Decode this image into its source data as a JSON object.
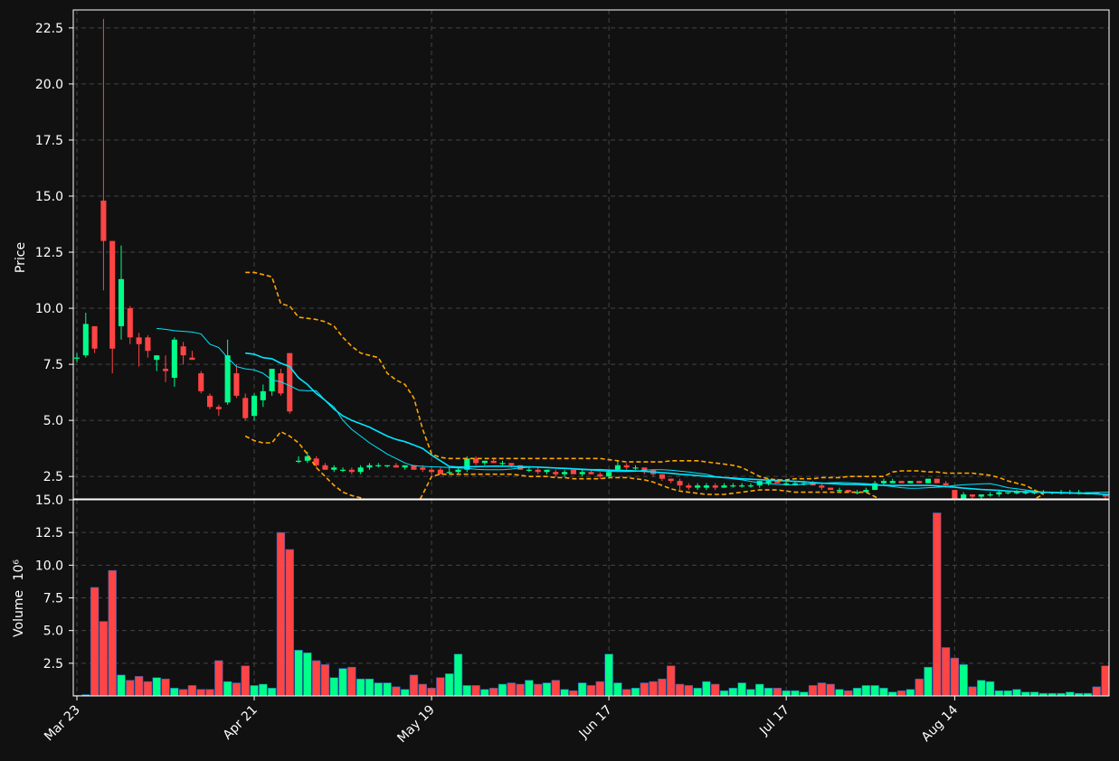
{
  "chart_data": [
    {
      "type": "candlestick",
      "ylabel": "Price",
      "ylim": [
        1.5,
        23.3
      ],
      "yticks": [
        "2.5",
        "5.0",
        "7.5",
        "10.0",
        "12.5",
        "15.0",
        "17.5",
        "20.0",
        "22.5"
      ],
      "grid": true,
      "up_color": "#00ff88",
      "down_color": "#ff4444",
      "ohlc": [
        [
          7.8,
          8.0,
          7.6,
          7.8
        ],
        [
          7.9,
          9.8,
          7.8,
          9.3
        ],
        [
          9.2,
          9.2,
          8.0,
          8.2
        ],
        [
          14.8,
          22.9,
          10.8,
          13.0
        ],
        [
          13.0,
          13.0,
          7.1,
          8.2
        ],
        [
          9.2,
          12.8,
          8.6,
          11.3
        ],
        [
          10.0,
          10.1,
          8.4,
          8.7
        ],
        [
          8.7,
          8.9,
          7.4,
          8.4
        ],
        [
          8.7,
          8.8,
          7.8,
          8.1
        ],
        [
          7.7,
          7.9,
          7.2,
          7.9
        ],
        [
          7.3,
          7.9,
          6.7,
          7.2
        ],
        [
          6.9,
          8.7,
          6.5,
          8.6
        ],
        [
          8.3,
          8.5,
          7.5,
          7.9
        ],
        [
          7.8,
          8.1,
          7.7,
          7.7
        ],
        [
          7.1,
          7.2,
          6.2,
          6.3
        ],
        [
          6.1,
          6.2,
          5.5,
          5.6
        ],
        [
          5.6,
          5.7,
          5.2,
          5.5
        ],
        [
          5.8,
          8.6,
          5.7,
          7.9
        ],
        [
          7.1,
          7.5,
          6.0,
          6.1
        ],
        [
          6.0,
          6.2,
          5.0,
          5.1
        ],
        [
          5.2,
          6.2,
          5.0,
          6.1
        ],
        [
          5.9,
          6.6,
          5.6,
          6.3
        ],
        [
          6.3,
          7.3,
          6.1,
          7.3
        ],
        [
          7.1,
          7.3,
          6.1,
          6.2
        ],
        [
          8.0,
          8.0,
          5.3,
          5.4
        ],
        [
          3.2,
          3.4,
          3.1,
          3.2
        ],
        [
          3.2,
          3.6,
          3.1,
          3.4
        ],
        [
          3.3,
          3.4,
          2.9,
          3.0
        ],
        [
          3.0,
          3.1,
          2.8,
          2.8
        ],
        [
          2.8,
          3.0,
          2.7,
          2.9
        ],
        [
          2.8,
          2.9,
          2.7,
          2.8
        ],
        [
          2.8,
          2.9,
          2.6,
          2.7
        ],
        [
          2.7,
          3.0,
          2.6,
          2.9
        ],
        [
          2.9,
          3.1,
          2.8,
          3.0
        ],
        [
          3.0,
          3.1,
          2.9,
          3.0
        ],
        [
          3.0,
          3.0,
          2.9,
          3.0
        ],
        [
          3.0,
          3.1,
          2.9,
          2.9
        ],
        [
          2.9,
          3.0,
          2.8,
          3.0
        ],
        [
          3.0,
          3.0,
          2.8,
          2.8
        ],
        [
          2.9,
          3.0,
          2.7,
          2.8
        ],
        [
          2.8,
          2.9,
          2.6,
          2.7
        ],
        [
          2.8,
          2.9,
          2.6,
          2.6
        ],
        [
          2.7,
          2.9,
          2.6,
          2.7
        ],
        [
          2.7,
          2.9,
          2.6,
          2.8
        ],
        [
          2.8,
          3.4,
          2.7,
          3.3
        ],
        [
          3.3,
          3.4,
          3.0,
          3.1
        ],
        [
          3.1,
          3.2,
          3.0,
          3.2
        ],
        [
          3.2,
          3.3,
          3.1,
          3.1
        ],
        [
          3.1,
          3.2,
          3.0,
          3.1
        ],
        [
          3.1,
          3.1,
          2.9,
          3.0
        ],
        [
          3.0,
          3.0,
          2.8,
          2.8
        ],
        [
          2.8,
          2.9,
          2.7,
          2.8
        ],
        [
          2.8,
          2.9,
          2.6,
          2.7
        ],
        [
          2.7,
          2.8,
          2.6,
          2.8
        ],
        [
          2.7,
          2.8,
          2.5,
          2.6
        ],
        [
          2.6,
          2.8,
          2.5,
          2.7
        ],
        [
          2.8,
          2.8,
          2.6,
          2.6
        ],
        [
          2.6,
          2.8,
          2.5,
          2.7
        ],
        [
          2.7,
          2.8,
          2.6,
          2.6
        ],
        [
          2.6,
          2.7,
          2.4,
          2.5
        ],
        [
          2.5,
          2.8,
          2.4,
          2.7
        ],
        [
          2.8,
          3.2,
          2.7,
          3.0
        ],
        [
          3.0,
          3.1,
          2.8,
          2.9
        ],
        [
          2.9,
          3.0,
          2.8,
          2.9
        ],
        [
          2.9,
          2.9,
          2.6,
          2.7
        ],
        [
          2.8,
          2.8,
          2.5,
          2.6
        ],
        [
          2.6,
          2.6,
          2.3,
          2.4
        ],
        [
          2.4,
          2.4,
          2.2,
          2.3
        ],
        [
          2.3,
          2.4,
          1.9,
          2.1
        ],
        [
          2.1,
          2.2,
          1.9,
          2.0
        ],
        [
          2.0,
          2.2,
          1.9,
          2.1
        ],
        [
          2.0,
          2.2,
          1.9,
          2.1
        ],
        [
          2.1,
          2.2,
          1.9,
          2.0
        ],
        [
          2.0,
          2.2,
          2.0,
          2.1
        ],
        [
          2.1,
          2.2,
          2.0,
          2.1
        ],
        [
          2.1,
          2.2,
          2.0,
          2.1
        ],
        [
          2.1,
          2.2,
          2.0,
          2.1
        ],
        [
          2.1,
          2.3,
          2.0,
          2.3
        ],
        [
          2.2,
          2.4,
          2.1,
          2.3
        ],
        [
          2.3,
          2.4,
          2.2,
          2.2
        ],
        [
          2.2,
          2.3,
          2.1,
          2.2
        ],
        [
          2.2,
          2.3,
          2.1,
          2.2
        ],
        [
          2.2,
          2.3,
          2.1,
          2.2
        ],
        [
          2.2,
          2.3,
          2.1,
          2.1
        ],
        [
          2.1,
          2.2,
          1.9,
          2.0
        ],
        [
          2.0,
          2.0,
          1.9,
          1.9
        ],
        [
          1.9,
          2.0,
          1.8,
          1.9
        ],
        [
          1.9,
          1.9,
          1.8,
          1.8
        ],
        [
          1.8,
          1.9,
          1.7,
          1.8
        ],
        [
          1.8,
          2.0,
          1.8,
          1.9
        ],
        [
          1.9,
          2.3,
          1.9,
          2.2
        ],
        [
          2.2,
          2.4,
          2.1,
          2.3
        ],
        [
          2.2,
          2.4,
          2.2,
          2.3
        ],
        [
          2.3,
          2.3,
          2.2,
          2.2
        ],
        [
          2.2,
          2.3,
          2.2,
          2.3
        ],
        [
          2.3,
          2.3,
          2.2,
          2.2
        ],
        [
          2.2,
          2.4,
          2.2,
          2.4
        ],
        [
          2.4,
          2.4,
          2.2,
          2.2
        ],
        [
          2.2,
          2.3,
          2.0,
          2.1
        ],
        [
          1.9,
          1.9,
          1.4,
          1.5
        ],
        [
          1.5,
          1.8,
          1.4,
          1.7
        ],
        [
          1.7,
          1.7,
          1.5,
          1.6
        ],
        [
          1.6,
          1.7,
          1.5,
          1.7
        ],
        [
          1.7,
          1.8,
          1.6,
          1.7
        ],
        [
          1.7,
          1.9,
          1.6,
          1.8
        ],
        [
          1.8,
          1.8,
          1.7,
          1.8
        ],
        [
          1.8,
          1.9,
          1.7,
          1.8
        ],
        [
          1.8,
          1.9,
          1.7,
          1.8
        ],
        [
          1.8,
          1.9,
          1.7,
          1.8
        ],
        [
          1.8,
          1.9,
          1.7,
          1.8
        ],
        [
          1.8,
          1.8,
          1.7,
          1.8
        ],
        [
          1.8,
          1.9,
          1.7,
          1.8
        ],
        [
          1.8,
          1.9,
          1.7,
          1.8
        ],
        [
          1.8,
          1.9,
          1.7,
          1.8
        ],
        [
          1.7,
          1.8,
          1.7,
          1.8
        ],
        [
          1.8,
          1.8,
          1.7,
          1.7
        ],
        [
          1.7,
          1.7,
          1.5,
          1.6
        ]
      ],
      "mavs": [
        {
          "color": "#00e5ff",
          "start": 9,
          "values": [
            9.1,
            9.06,
            9.0,
            8.97,
            8.94,
            8.86,
            8.4,
            8.25,
            7.8,
            7.4,
            7.3,
            7.25,
            7.1,
            6.8,
            6.72,
            6.55,
            6.35,
            6.32,
            6.32,
            5.9,
            5.6,
            5.0,
            4.6,
            4.3,
            4.0,
            3.75,
            3.5,
            3.3,
            3.1,
            2.98,
            2.95,
            2.93,
            2.92,
            2.9,
            2.88,
            2.86,
            2.82,
            2.8,
            2.8,
            2.8,
            2.83,
            2.88,
            2.91,
            2.91,
            2.9,
            2.87,
            2.85,
            2.83,
            2.8,
            2.78,
            2.75,
            2.73,
            2.72,
            2.72,
            2.73,
            2.78,
            2.8,
            2.8,
            2.78,
            2.74,
            2.7,
            2.65,
            2.6,
            2.5,
            2.45,
            2.4,
            2.35,
            2.28,
            2.22,
            2.18,
            2.15,
            2.13,
            2.12,
            2.15,
            2.18,
            2.2,
            2.22,
            2.23,
            2.22,
            2.2,
            2.18,
            2.15,
            2.1,
            2.05,
            2.0,
            1.97,
            1.98,
            2.0,
            2.02,
            2.05,
            2.1,
            2.13,
            2.15,
            2.17,
            2.18,
            2.1,
            2.0,
            1.95,
            1.9,
            1.85,
            1.8,
            1.78,
            1.75,
            1.75,
            1.76,
            1.78,
            1.79,
            1.8,
            1.8,
            1.8,
            1.79,
            1.78,
            1.77,
            1.75,
            1.73
          ]
        },
        {
          "color": "#00e5ff",
          "start": 19,
          "values": [
            8.0,
            7.95,
            7.8,
            7.75,
            7.55,
            7.4,
            6.9,
            6.6,
            6.2,
            5.9,
            5.5,
            5.2,
            5.0,
            4.85,
            4.7,
            4.5,
            4.3,
            4.15,
            4.05,
            3.9,
            3.75,
            3.45,
            3.2,
            2.95,
            2.92,
            2.93,
            2.94,
            2.95,
            2.96,
            2.96,
            2.95,
            2.94,
            2.93,
            2.92,
            2.9,
            2.88,
            2.86,
            2.84,
            2.82,
            2.8,
            2.8,
            2.78,
            2.77,
            2.76,
            2.75,
            2.73,
            2.7,
            2.67,
            2.64,
            2.6,
            2.57,
            2.54,
            2.51,
            2.48,
            2.45,
            2.43,
            2.4,
            2.38,
            2.36,
            2.34,
            2.32,
            2.3,
            2.28,
            2.26,
            2.23,
            2.2,
            2.18,
            2.16,
            2.15,
            2.14,
            2.13,
            2.12,
            2.11,
            2.1,
            2.1,
            2.1,
            2.1,
            2.1,
            2.08,
            2.05,
            2.02,
            1.98,
            1.95,
            1.92,
            1.9,
            1.88,
            1.85,
            1.83,
            1.82,
            1.81,
            1.8,
            1.79,
            1.78,
            1.77,
            1.75,
            1.74,
            1.72,
            1.7,
            1.68
          ]
        },
        {
          "color": "#ffa500",
          "start": 19,
          "dashed": true,
          "values": [
            11.6,
            11.6,
            11.5,
            11.4,
            10.2,
            10.1,
            9.6,
            9.55,
            9.5,
            9.4,
            9.2,
            8.7,
            8.3,
            8.0,
            7.9,
            7.8,
            7.1,
            6.8,
            6.6,
            6.0,
            4.6,
            3.5,
            3.35,
            3.3,
            3.3,
            3.3,
            3.3,
            3.3,
            3.3,
            3.3,
            3.3,
            3.3,
            3.3,
            3.3,
            3.3,
            3.3,
            3.3,
            3.3,
            3.3,
            3.3,
            3.3,
            3.25,
            3.2,
            3.15,
            3.15,
            3.15,
            3.15,
            3.15,
            3.2,
            3.2,
            3.2,
            3.2,
            3.15,
            3.1,
            3.05,
            3.0,
            2.9,
            2.7,
            2.5,
            2.4,
            2.35,
            2.35,
            2.4,
            2.4,
            2.4,
            2.45,
            2.45,
            2.45,
            2.5,
            2.5,
            2.5,
            2.5,
            2.5,
            2.7,
            2.75,
            2.75,
            2.75,
            2.7,
            2.7,
            2.65,
            2.65,
            2.65,
            2.65,
            2.6,
            2.55,
            2.45,
            2.3,
            2.2,
            2.1,
            1.9,
            1.7
          ]
        },
        {
          "color": "#ffa500",
          "start": 19,
          "dashed": true,
          "values": [
            4.3,
            4.1,
            4.0,
            4.0,
            4.5,
            4.3,
            4.0,
            3.5,
            2.9,
            2.5,
            2.1,
            1.8,
            1.65,
            1.55,
            1.4,
            1.2,
            1.05,
            1.0,
            0.95,
            1.0,
            1.7,
            2.5,
            2.6,
            2.6,
            2.6,
            2.6,
            2.6,
            2.6,
            2.6,
            2.6,
            2.6,
            2.55,
            2.5,
            2.5,
            2.5,
            2.45,
            2.45,
            2.4,
            2.4,
            2.4,
            2.4,
            2.45,
            2.45,
            2.45,
            2.4,
            2.35,
            2.25,
            2.1,
            1.95,
            1.85,
            1.8,
            1.75,
            1.7,
            1.7,
            1.7,
            1.75,
            1.8,
            1.85,
            1.9,
            1.9,
            1.9,
            1.85,
            1.8,
            1.8,
            1.8,
            1.8,
            1.8,
            1.8,
            1.8,
            1.8,
            1.8,
            1.6,
            1.4,
            1.35,
            1.3,
            1.25,
            1.2,
            1.2,
            1.25,
            1.25,
            1.2,
            1.2,
            1.2,
            1.2,
            1.2,
            1.25,
            1.3,
            1.35,
            1.4,
            1.5,
            1.7
          ]
        }
      ]
    },
    {
      "type": "bar",
      "ylabel": "Volume",
      "yscale_label": "10⁶",
      "ylim": [
        0,
        15.0
      ],
      "yticks": [
        "2.5",
        "5.0",
        "7.5",
        "10.0",
        "12.5",
        "15.0"
      ],
      "grid": true,
      "values": [
        0.05,
        0.1,
        8.3,
        5.7,
        9.6,
        1.6,
        1.2,
        1.5,
        1.1,
        1.4,
        1.3,
        0.6,
        0.5,
        0.8,
        0.5,
        0.5,
        2.7,
        1.1,
        1.0,
        2.3,
        0.8,
        0.9,
        0.6,
        12.5,
        11.2,
        3.5,
        3.3,
        2.7,
        2.4,
        1.4,
        2.1,
        2.2,
        1.3,
        1.3,
        1.0,
        1.0,
        0.7,
        0.5,
        1.6,
        0.9,
        0.6,
        1.4,
        1.7,
        3.2,
        0.8,
        0.8,
        0.5,
        0.6,
        0.9,
        1.0,
        0.9,
        1.2,
        0.9,
        1.0,
        1.2,
        0.5,
        0.4,
        1.0,
        0.8,
        1.1,
        3.2,
        1.0,
        0.5,
        0.6,
        1.0,
        1.1,
        1.3,
        2.3,
        0.9,
        0.8,
        0.6,
        1.1,
        0.9,
        0.4,
        0.6,
        1.0,
        0.5,
        0.9,
        0.6,
        0.6,
        0.4,
        0.4,
        0.3,
        0.8,
        1.0,
        0.9,
        0.5,
        0.4,
        0.6,
        0.8,
        0.8,
        0.6,
        0.3,
        0.4,
        0.5,
        1.3,
        2.2,
        14.0,
        3.7,
        2.9,
        2.4,
        0.7,
        1.2,
        1.1,
        0.4,
        0.4,
        0.5,
        0.3,
        0.3,
        0.2,
        0.2,
        0.2,
        0.3,
        0.2,
        0.2,
        0.7,
        2.3
      ]
    }
  ],
  "xaxis": {
    "ticks": [
      {
        "label": "Mar 23",
        "index": 0
      },
      {
        "label": "Apr 21",
        "index": 20
      },
      {
        "label": "May 19",
        "index": 40
      },
      {
        "label": "Jun 17",
        "index": 60
      },
      {
        "label": "Jul 17",
        "index": 80
      },
      {
        "label": "Aug 14",
        "index": 99
      }
    ]
  },
  "theme": {
    "background": "#111111",
    "plot_background": "#111111",
    "grid_color": "#444444",
    "axis_color": "#ffffff"
  }
}
